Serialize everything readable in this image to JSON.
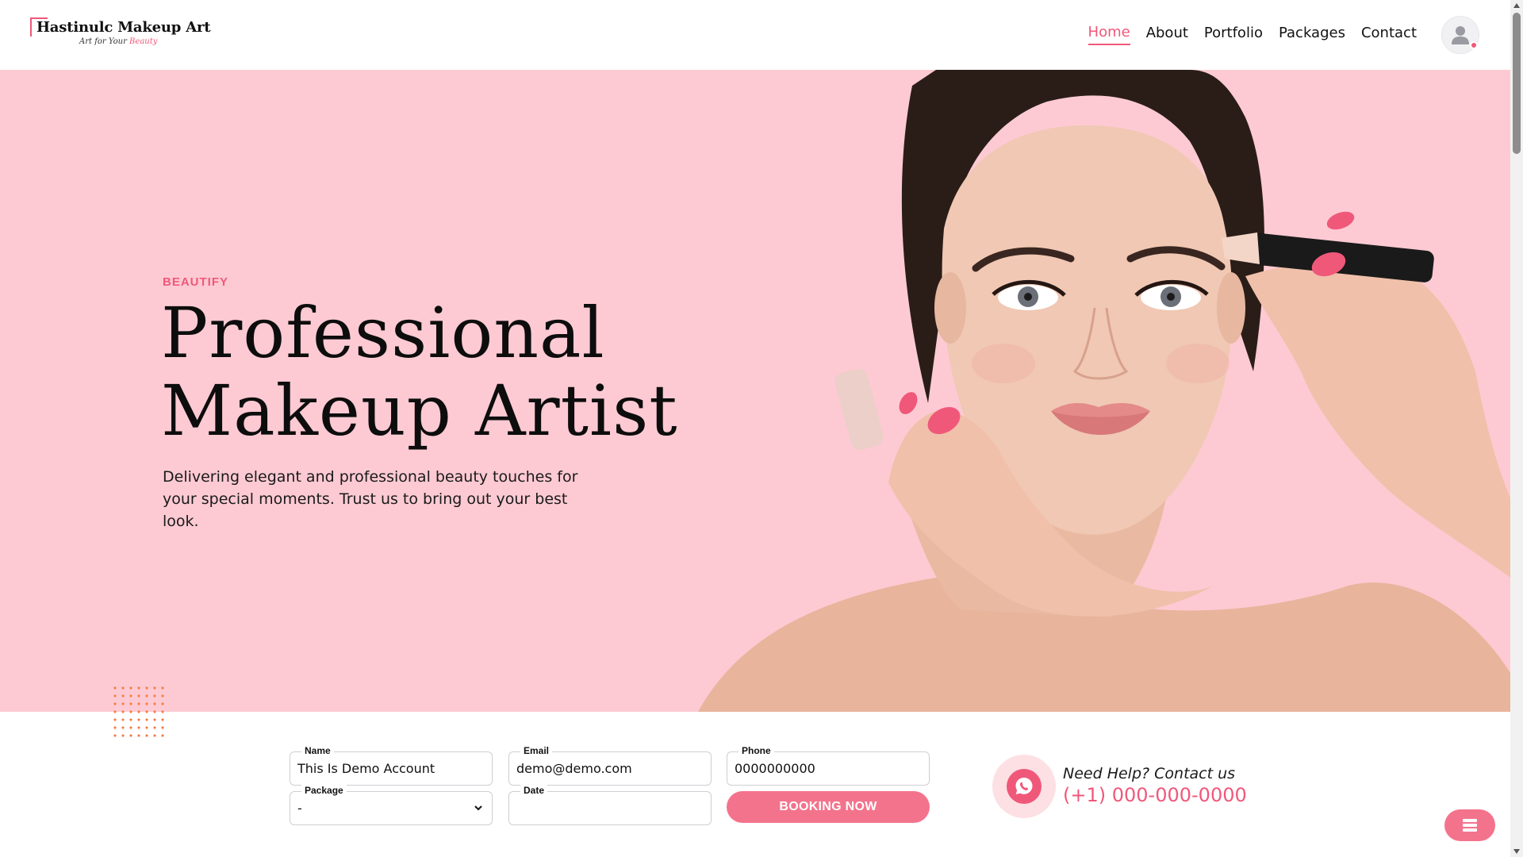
{
  "brand": {
    "name": "Hastinulc Makeup Art",
    "tagline_prefix": "Art for Your",
    "tagline_highlight": "Beauty"
  },
  "nav": {
    "items": [
      {
        "label": "Home",
        "active": true
      },
      {
        "label": "About",
        "active": false
      },
      {
        "label": "Portfolio",
        "active": false
      },
      {
        "label": "Packages",
        "active": false
      },
      {
        "label": "Contact",
        "active": false
      }
    ]
  },
  "hero": {
    "eyebrow": "BEAUTIFY",
    "title_line1": "Professional",
    "title_line2": "Makeup Artist",
    "description": "Delivering elegant and professional beauty touches for your special moments. Trust us to bring out your best look."
  },
  "booking": {
    "name": {
      "label": "Name",
      "value": "This Is Demo Account"
    },
    "email": {
      "label": "Email",
      "value": "demo@demo.com"
    },
    "phone": {
      "label": "Phone",
      "value": "0000000000"
    },
    "package": {
      "label": "Package",
      "value": "-"
    },
    "date": {
      "label": "Date",
      "value": ""
    },
    "submit_label": "BOOKING NOW"
  },
  "help": {
    "title": "Need Help? Contact us",
    "phone": "(+1) 000-000-0000"
  },
  "icons": {
    "avatar": "user-icon",
    "whatsapp": "whatsapp-icon",
    "fab": "menu-stack-icon",
    "select": "chevron-down-icon"
  },
  "colors": {
    "accent": "#f0587a",
    "button": "#f4738c",
    "hero_bg": "#fdcad3",
    "dots": "#f2804a"
  }
}
